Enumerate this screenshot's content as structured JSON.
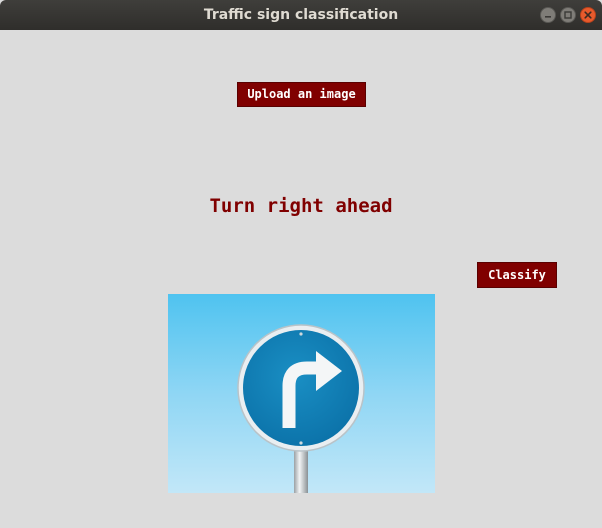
{
  "window": {
    "title": "Traffic sign classification"
  },
  "buttons": {
    "upload_label": "Upload an image",
    "classify_label": "Classify"
  },
  "result": {
    "text": "Turn right ahead"
  },
  "image": {
    "subject": "blue circular turn-right-ahead traffic sign on a pole against a light blue sky"
  },
  "colors": {
    "button_bg": "#800000",
    "button_text": "#ffffff",
    "result_text": "#800000",
    "window_bg": "#dcdcdc",
    "titlebar_bg": "#3c3b37",
    "close_button": "#e75a2c"
  },
  "icons": {
    "minimize": "minimize-icon",
    "maximize": "maximize-icon",
    "close": "close-icon"
  }
}
